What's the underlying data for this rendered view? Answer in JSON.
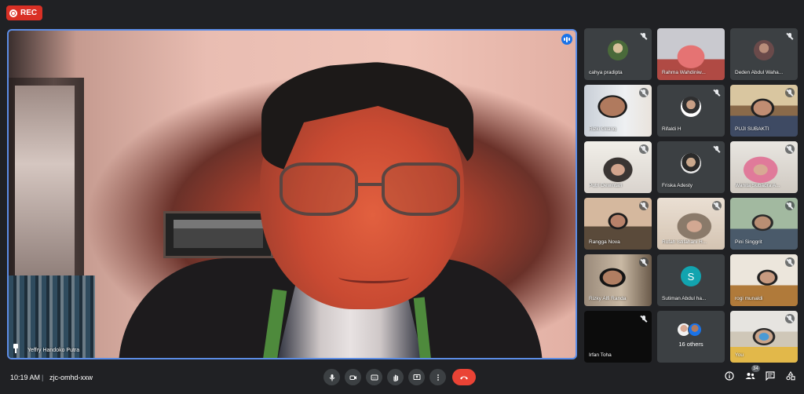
{
  "recording": {
    "label": "REC"
  },
  "main_speaker": {
    "name": "Yeffry Handoko Putra"
  },
  "participants": [
    {
      "name": "cahya pradipta",
      "style": "avatar-photo1",
      "muted": true
    },
    {
      "name": "Rahma Wahdiniw...",
      "style": "video-rahma",
      "muted": false
    },
    {
      "name": "Deden Abdul Waha...",
      "style": "avatar-photo4",
      "muted": true
    },
    {
      "name": "Rizki Gilang",
      "style": "video-rizki",
      "muted": true
    },
    {
      "name": "Rifaldi H",
      "style": "avatar-photo3",
      "muted": true
    },
    {
      "name": "PUJI SUBAKTI",
      "style": "video-puji",
      "muted": true
    },
    {
      "name": "Putri Dewintari",
      "style": "video-putri",
      "muted": true
    },
    {
      "name": "Friska Adesty",
      "style": "avatar-photo2",
      "muted": true
    },
    {
      "name": "Wanita Subadra A...",
      "style": "video-wanita",
      "muted": true
    },
    {
      "name": "Rangga Nova",
      "style": "video-rangga",
      "muted": true
    },
    {
      "name": "Rofah Istifahani H...",
      "style": "video-rofah",
      "muted": true
    },
    {
      "name": "Pini Singgrit",
      "style": "video-pini",
      "muted": true
    },
    {
      "name": "Rizky Alfi Randa",
      "style": "video-rizkyalfi",
      "muted": true
    },
    {
      "name": "Sutiman Abdul ha...",
      "style": "avatar-letter",
      "letter": "S",
      "muted": false
    },
    {
      "name": "rogi munaldi",
      "style": "video-rogi",
      "muted": true
    },
    {
      "name": "Irfan Toha",
      "style": "dark",
      "muted": true
    },
    {
      "name": "",
      "style": "others",
      "others_label": "16 others",
      "muted": false
    },
    {
      "name": "You",
      "style": "video-you",
      "muted": true
    }
  ],
  "meeting": {
    "time": "10:19 AM",
    "separator": "|",
    "code": "zjc-omhd-xxw"
  },
  "controls": [
    {
      "name": "mic-button",
      "icon": "mic-icon"
    },
    {
      "name": "camera-button",
      "icon": "camera-icon"
    },
    {
      "name": "captions-button",
      "icon": "captions-icon"
    },
    {
      "name": "raise-hand-button",
      "icon": "hand-icon"
    },
    {
      "name": "present-button",
      "icon": "present-icon"
    },
    {
      "name": "more-options-button",
      "icon": "more-icon"
    },
    {
      "name": "leave-call-button",
      "icon": "phone-end-icon"
    }
  ],
  "people_count": "34",
  "colors": {
    "background": "#202124",
    "tile": "#3c4043",
    "accent": "#1a73e8",
    "end_call": "#ea4335",
    "rec": "#d93025"
  }
}
